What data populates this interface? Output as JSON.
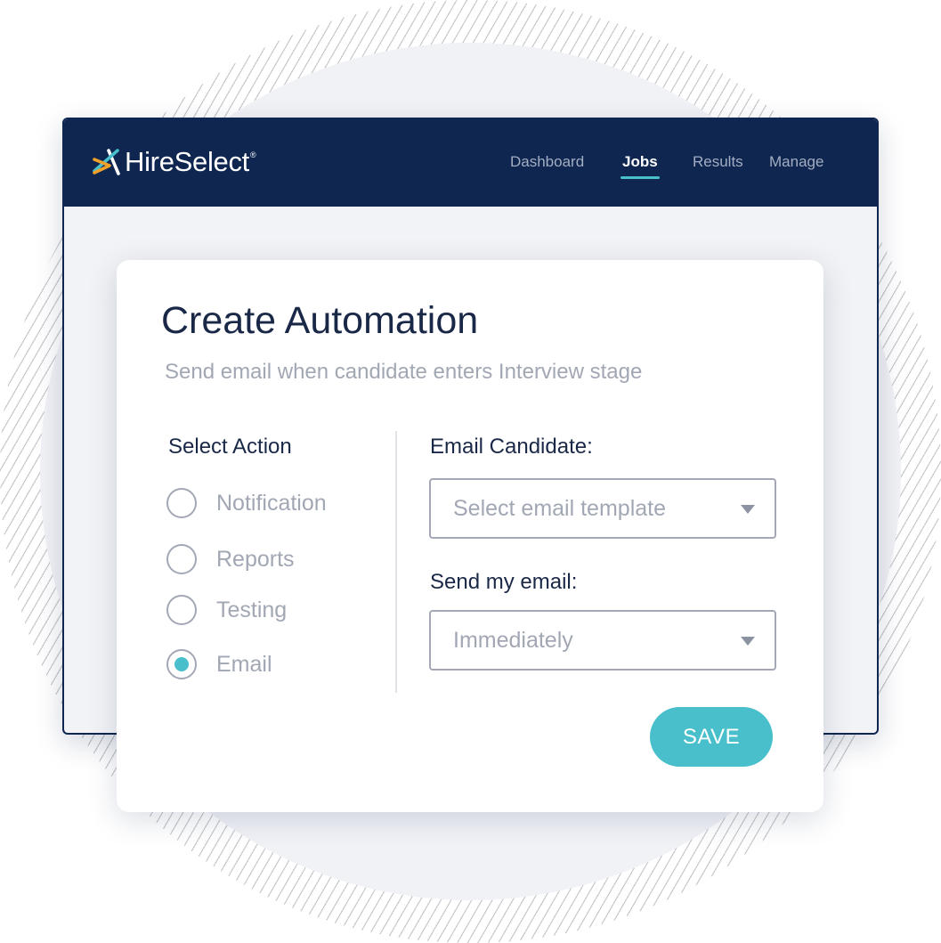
{
  "app": {
    "name": "HireSelect",
    "registered_mark": "®",
    "logo_icon": "hireselect-x-logo-icon"
  },
  "nav": {
    "items": [
      {
        "label": "Dashboard",
        "active": false
      },
      {
        "label": "Jobs",
        "active": true
      },
      {
        "label": "Results",
        "active": false
      },
      {
        "label": "Manage",
        "active": false
      }
    ]
  },
  "card": {
    "title": "Create Automation",
    "subtitle": "Send email when candidate enters Interview stage"
  },
  "actions": {
    "heading": "Select Action",
    "options": [
      {
        "label": "Notification",
        "checked": false
      },
      {
        "label": "Reports",
        "checked": false
      },
      {
        "label": "Testing",
        "checked": false
      },
      {
        "label": "Email",
        "checked": true
      }
    ]
  },
  "email_candidate": {
    "label": "Email Candidate:",
    "value": "Select email template"
  },
  "send_email": {
    "label": "Send my email:",
    "value": "Immediately"
  },
  "save_label": "SAVE",
  "colors": {
    "navy": "#0f2650",
    "accent": "#48bfcb",
    "logo_orange": "#f0a12b",
    "muted_text": "#a2a7b4"
  }
}
